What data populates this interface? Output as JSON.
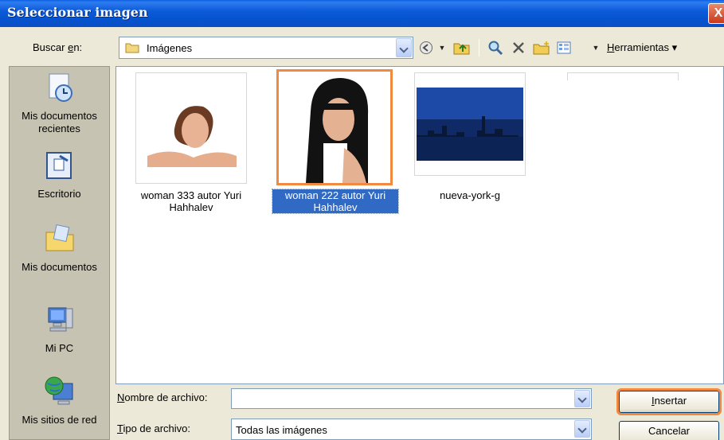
{
  "window": {
    "title": "Seleccionar imagen",
    "close_glyph": "X"
  },
  "lookin": {
    "label": "Buscar en:",
    "accesskey": "e",
    "folder": "Imágenes"
  },
  "toolbar": {
    "icons": [
      "back-icon",
      "up-folder-icon",
      "search-web-icon",
      "delete-icon",
      "new-folder-icon",
      "views-icon"
    ],
    "tools_label": "Herramientas"
  },
  "places": [
    {
      "label": "Mis documentos recientes",
      "icon": "recent-documents-icon"
    },
    {
      "label": "Escritorio",
      "icon": "desktop-icon"
    },
    {
      "label": "Mis documentos",
      "icon": "my-documents-icon"
    },
    {
      "label": "Mi PC",
      "icon": "my-computer-icon"
    },
    {
      "label": "Mis sitios de red",
      "icon": "network-places-icon"
    }
  ],
  "files": [
    {
      "name": "woman 333 autor Yuri Hahhalev",
      "selected": false
    },
    {
      "name": "woman 222 autor Yuri Hahhalev",
      "selected": true
    },
    {
      "name": "nueva-york-g",
      "selected": false
    },
    {
      "name": "",
      "selected": false
    }
  ],
  "filename": {
    "label": "Nombre de archivo:",
    "value": ""
  },
  "filetype": {
    "label": "Tipo de archivo:",
    "value": "Todas las imágenes"
  },
  "buttons": {
    "insert": "Insertar",
    "cancel": "Cancelar"
  },
  "colors": {
    "accent": "#f08a40",
    "selection": "#316ac5",
    "titlebar": "#0653cf"
  }
}
